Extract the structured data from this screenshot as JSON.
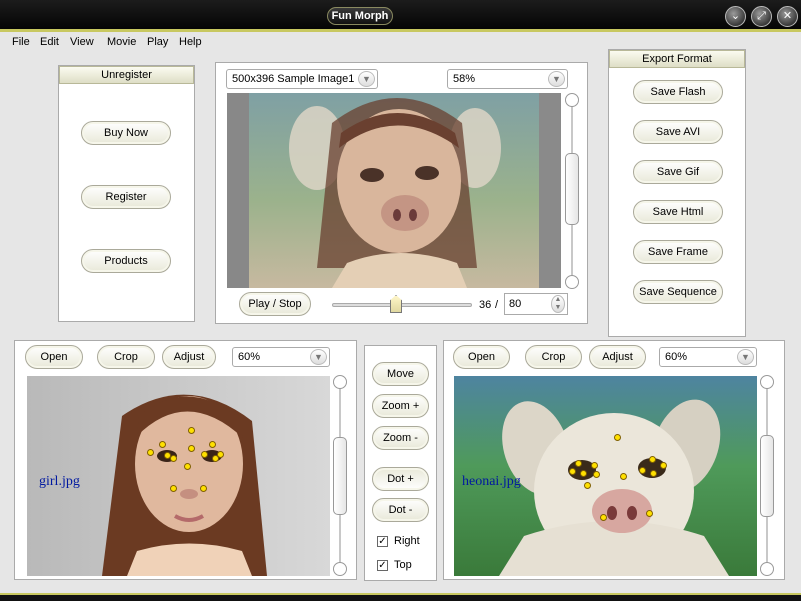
{
  "window": {
    "title": "Fun Morph",
    "minimize_glyph": "⌄",
    "maximize_glyph": "⤢",
    "close_glyph": "✕"
  },
  "menu": [
    "File",
    "Edit",
    "View",
    "Movie",
    "Play",
    "Help"
  ],
  "unregister": {
    "header": "Unregister",
    "buy_now": "Buy Now",
    "register": "Register",
    "products": "Products"
  },
  "preview": {
    "sample_select": "500x396 Sample Image1",
    "zoom_select": "58%",
    "play_stop": "Play / Stop",
    "frame_current": "36",
    "frame_separator": "/",
    "frame_total": "80",
    "frame_progress": 0.45
  },
  "export": {
    "header": "Export Format",
    "buttons": [
      "Save Flash",
      "Save AVI",
      "Save Gif",
      "Save Html",
      "Save Frame",
      "Save Sequence"
    ]
  },
  "source_left": {
    "open": "Open",
    "crop": "Crop",
    "adjust": "Adjust",
    "zoom": "60%",
    "filename": "girl.jpg"
  },
  "tools": {
    "move": "Move",
    "zoom_in": "Zoom +",
    "zoom_out": "Zoom -",
    "dot_add": "Dot +",
    "dot_remove": "Dot -",
    "right_label": "Right",
    "right_checked": true,
    "top_label": "Top",
    "top_checked": true
  },
  "source_right": {
    "open": "Open",
    "crop": "Crop",
    "adjust": "Adjust",
    "zoom": "60%",
    "filename": "heonai.jpg"
  },
  "icons": {
    "dropdown": "chevron-down-icon",
    "spinner": "spinner-icon",
    "check": "checkmark-icon"
  },
  "colors": {
    "title_bar": "#0a0a0a",
    "accent_olive": "#c8c860",
    "filename_blue": "#0018a0",
    "marker_yellow": "#ffe000"
  }
}
